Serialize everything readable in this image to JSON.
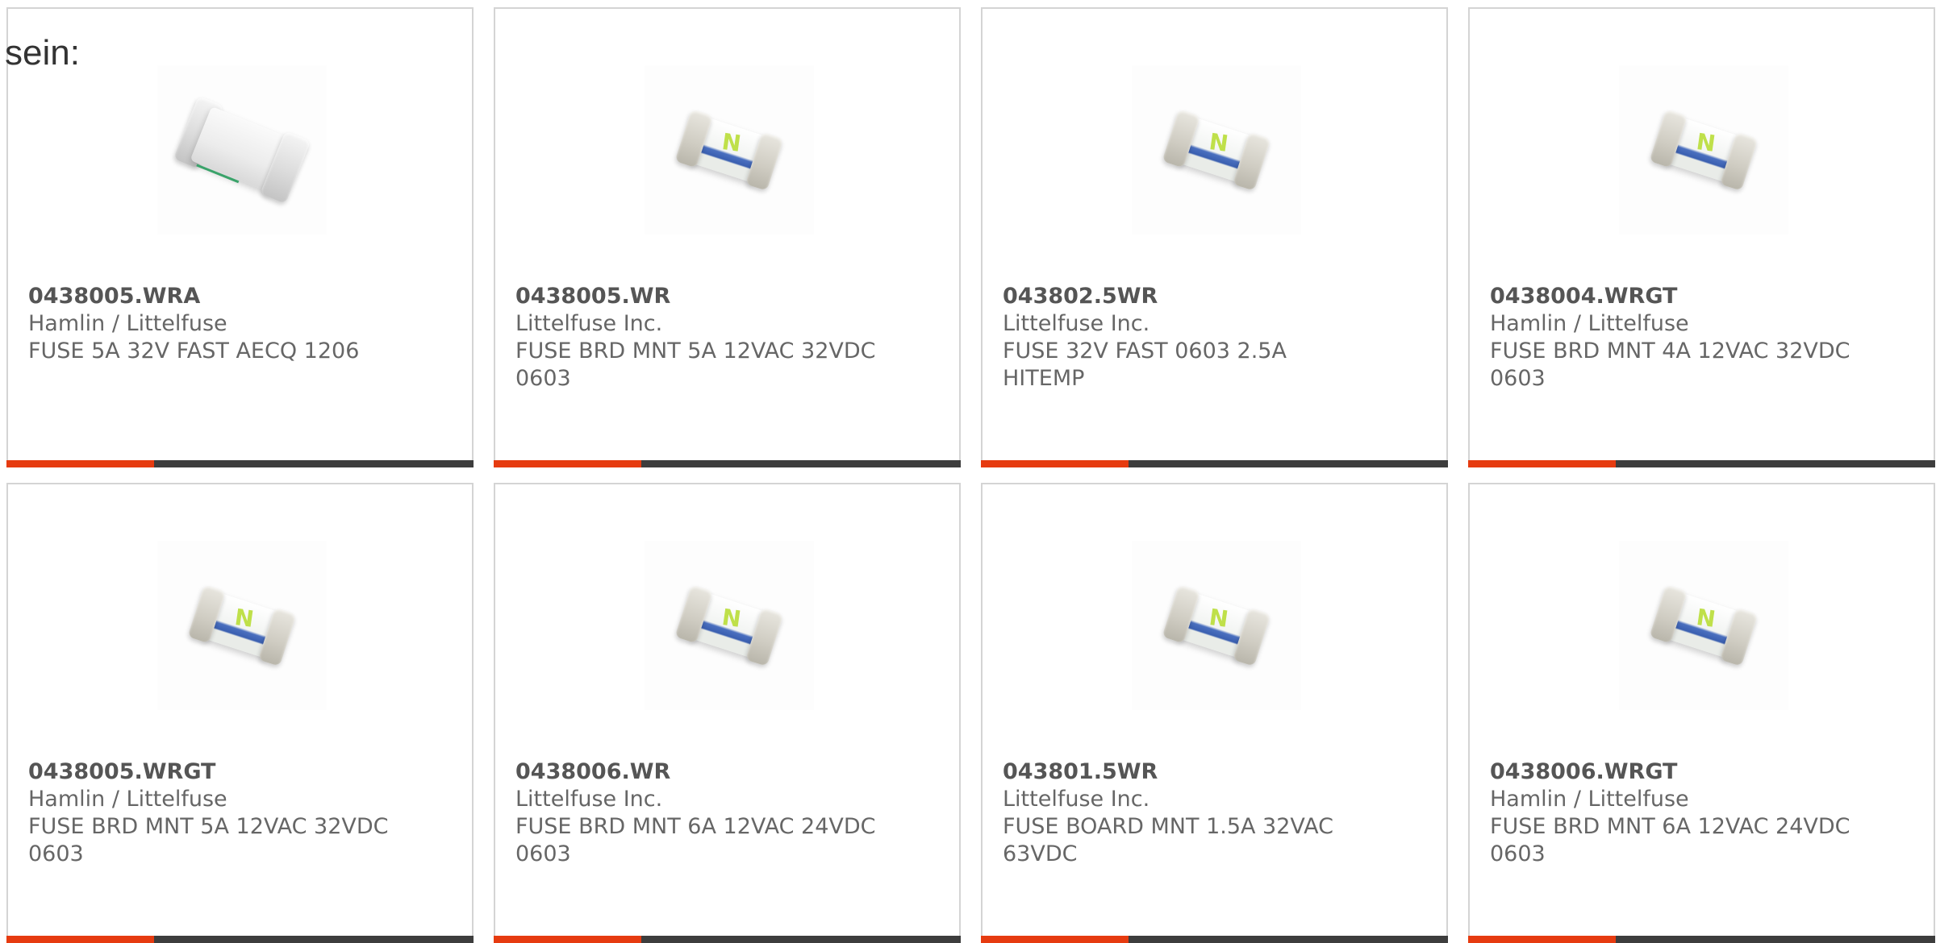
{
  "lead_text": "sein:",
  "colors": {
    "accent": "#e63b10",
    "bar": "#3d3d3d",
    "card_border": "#d4d4d4",
    "text": "#666666"
  },
  "products": [
    {
      "part_number": "0438005.WRA",
      "manufacturer": "Hamlin / Littelfuse",
      "description": "FUSE 5A 32V FAST AECQ 1206",
      "image": "smd-fuse-1206-white-icon"
    },
    {
      "part_number": "0438005.WR",
      "manufacturer": "Littelfuse Inc.",
      "description": "FUSE BRD MNT 5A 12VAC 32VDC 0603",
      "image": "smd-fuse-0603-icon"
    },
    {
      "part_number": "043802.5WR",
      "manufacturer": "Littelfuse Inc.",
      "description": "FUSE 32V FAST 0603 2.5A HITEMP",
      "image": "smd-fuse-0603-icon"
    },
    {
      "part_number": "0438004.WRGT",
      "manufacturer": "Hamlin / Littelfuse",
      "description": "FUSE BRD MNT 4A 12VAC 32VDC 0603",
      "image": "smd-fuse-0603-icon"
    },
    {
      "part_number": "0438005.WRGT",
      "manufacturer": "Hamlin / Littelfuse",
      "description": "FUSE BRD MNT 5A 12VAC 32VDC 0603",
      "image": "smd-fuse-0603-icon"
    },
    {
      "part_number": "0438006.WR",
      "manufacturer": "Littelfuse Inc.",
      "description": "FUSE BRD MNT 6A 12VAC 24VDC 0603",
      "image": "smd-fuse-0603-icon"
    },
    {
      "part_number": "043801.5WR",
      "manufacturer": "Littelfuse Inc.",
      "description": "FUSE BOARD MNT 1.5A 32VAC 63VDC",
      "image": "smd-fuse-0603-icon"
    },
    {
      "part_number": "0438006.WRGT",
      "manufacturer": "Hamlin / Littelfuse",
      "description": "FUSE BRD MNT 6A 12VAC 24VDC 0603",
      "image": "smd-fuse-0603-icon"
    }
  ]
}
